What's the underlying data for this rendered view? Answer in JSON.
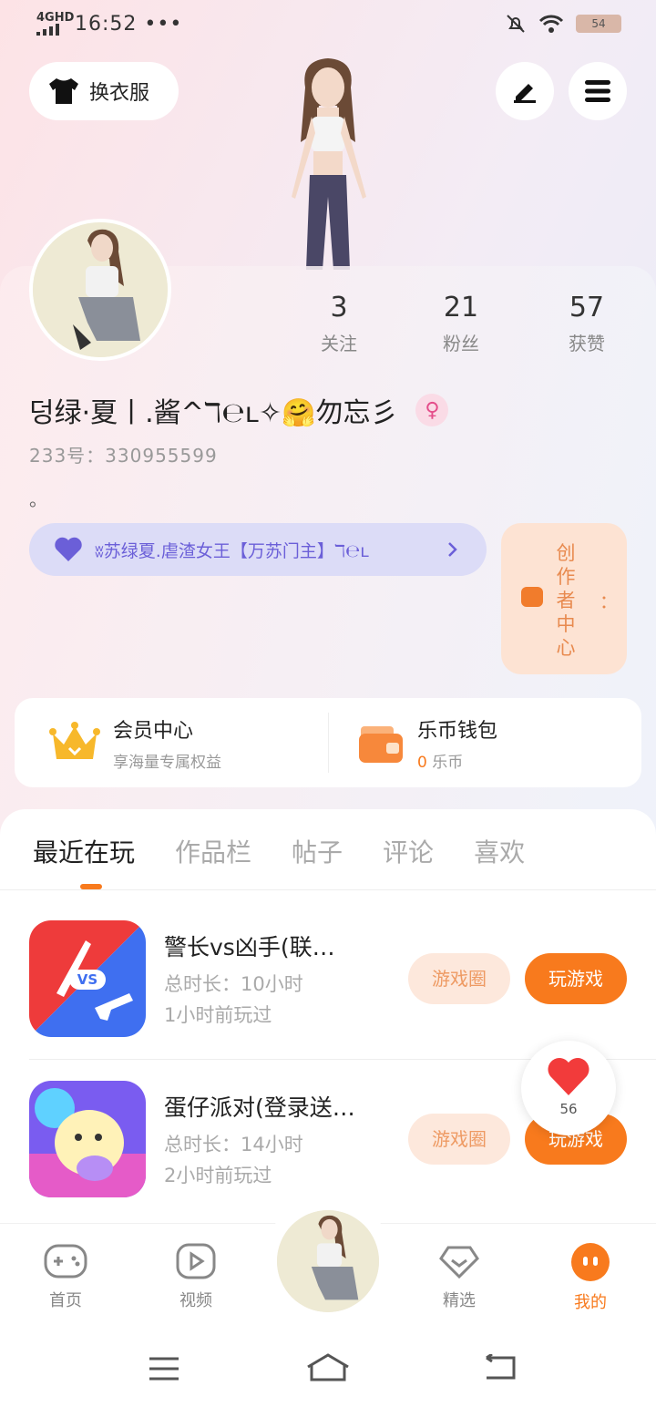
{
  "status_bar": {
    "network": "4GHD",
    "time": "16:52",
    "more": "•••",
    "battery": "54"
  },
  "top": {
    "outfit_label": "换衣服"
  },
  "profile": {
    "stats": [
      {
        "num": "3",
        "label": "关注"
      },
      {
        "num": "21",
        "label": "粉丝"
      },
      {
        "num": "57",
        "label": "获赞"
      }
    ],
    "nickname": "덩绿·夏丨.酱^ℸ℮ʟ✧🤗勿忘彡",
    "uid": "233号：330955599",
    "bio": "。",
    "guild": "ʬ苏绿夏.虐渣女王【万苏门主】ℸ℮ʟ",
    "creator_center": "创作者中心",
    "creator_colon": "："
  },
  "vip": {
    "member_title": "会员中心",
    "member_sub": "享海量专属权益",
    "wallet_title": "乐币钱包",
    "wallet_amount": "0",
    "wallet_unit": "乐币"
  },
  "tabs": [
    "最近在玩",
    "作品栏",
    "帖子",
    "评论",
    "喜欢"
  ],
  "games": [
    {
      "name": "警长vs凶手(联…",
      "duration": "总时长：10小时",
      "last_played": "1小时前玩过",
      "circle_btn": "游戏圈",
      "play_btn": "玩游戏"
    },
    {
      "name": "蛋仔派对(登录送…",
      "duration": "总时长：14小时",
      "last_played": "2小时前玩过",
      "circle_btn": "游戏圈",
      "play_btn": "玩游戏"
    }
  ],
  "float_like": {
    "count": "56"
  },
  "nav": {
    "home": "首页",
    "video": "视频",
    "featured": "精选",
    "mine": "我的"
  },
  "colors": {
    "accent": "#f87a1d",
    "guild_bg": "#dcdcf7",
    "guild_text": "#6b5fd8"
  }
}
